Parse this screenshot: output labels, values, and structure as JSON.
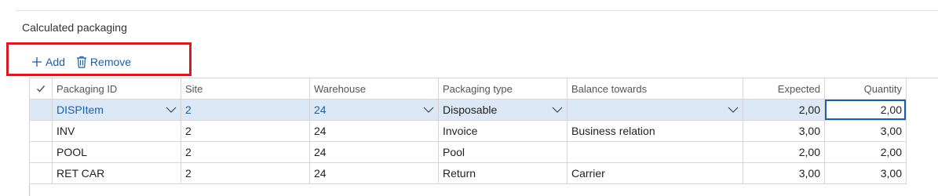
{
  "section": {
    "title": "Calculated packaging"
  },
  "toolbar": {
    "add_label": "Add",
    "remove_label": "Remove"
  },
  "colors": {
    "accent": "#1b5fa8",
    "highlight": "#d81a22",
    "selected_row": "#dce8f5"
  },
  "icons": {
    "add": "plus-icon",
    "remove": "trash-icon",
    "dropdown": "chevron-down-icon",
    "select_all": "checkmark-icon"
  },
  "grid": {
    "columns": [
      "Packaging ID",
      "Site",
      "Warehouse",
      "Packaging type",
      "Balance towards",
      "Expected",
      "Quantity"
    ],
    "rows": [
      {
        "packaging_id": "DISPItem",
        "site": "2",
        "warehouse": "24",
        "packaging_type": "Disposable",
        "balance_towards": "",
        "expected": "2,00",
        "quantity": "2,00"
      },
      {
        "packaging_id": "INV",
        "site": "2",
        "warehouse": "24",
        "packaging_type": "Invoice",
        "balance_towards": "Business relation",
        "expected": "3,00",
        "quantity": "3,00"
      },
      {
        "packaging_id": "POOL",
        "site": "2",
        "warehouse": "24",
        "packaging_type": "Pool",
        "balance_towards": "",
        "expected": "2,00",
        "quantity": "2,00"
      },
      {
        "packaging_id": "RET CAR",
        "site": "2",
        "warehouse": "24",
        "packaging_type": "Return",
        "balance_towards": "Carrier",
        "expected": "3,00",
        "quantity": "3,00"
      }
    ]
  }
}
